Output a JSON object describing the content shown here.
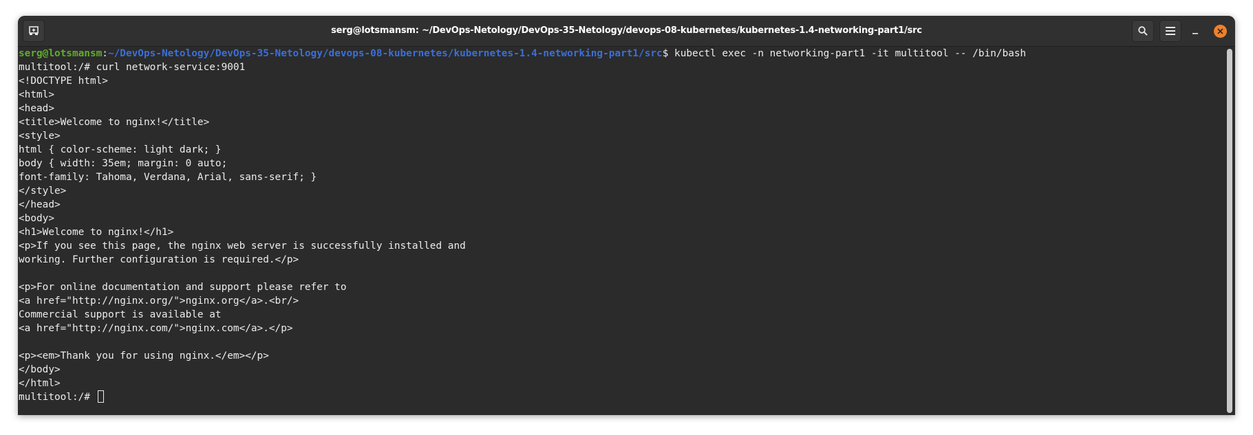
{
  "window": {
    "title": "serg@lotsmansm: ~/DevOps-Netology/DevOps-35-Netology/devops-08-kubernetes/kubernetes-1.4-networking-part1/src"
  },
  "icons": {
    "new_tab": "new-tab-icon",
    "search": "search-icon",
    "menu": "hamburger-menu-icon",
    "minimize": "minimize-icon",
    "close": "close-icon"
  },
  "colors": {
    "background": "#2b2b2b",
    "foreground": "#ececec",
    "user_host": "#5fae2a",
    "path": "#3b6fd8",
    "close_button": "#f0802a"
  },
  "terminal": {
    "prompt": {
      "user_host": "serg@lotsmansm",
      "separator": ":",
      "path": "~/DevOps-Netology/DevOps-35-Netology/devops-08-kubernetes/kubernetes-1.4-networking-part1/src",
      "symbol": "$",
      "command": " kubectl exec -n networking-part1 -it multitool -- /bin/bash"
    },
    "lines": [
      "multitool:/# curl network-service:9001",
      "<!DOCTYPE html>",
      "<html>",
      "<head>",
      "<title>Welcome to nginx!</title>",
      "<style>",
      "html { color-scheme: light dark; }",
      "body { width: 35em; margin: 0 auto;",
      "font-family: Tahoma, Verdana, Arial, sans-serif; }",
      "</style>",
      "</head>",
      "<body>",
      "<h1>Welcome to nginx!</h1>",
      "<p>If you see this page, the nginx web server is successfully installed and",
      "working. Further configuration is required.</p>",
      "",
      "<p>For online documentation and support please refer to",
      "<a href=\"http://nginx.org/\">nginx.org</a>.<br/>",
      "Commercial support is available at",
      "<a href=\"http://nginx.com/\">nginx.com</a>.</p>",
      "",
      "<p><em>Thank you for using nginx.</em></p>",
      "</body>",
      "</html>"
    ],
    "final_prompt": "multitool:/# "
  }
}
